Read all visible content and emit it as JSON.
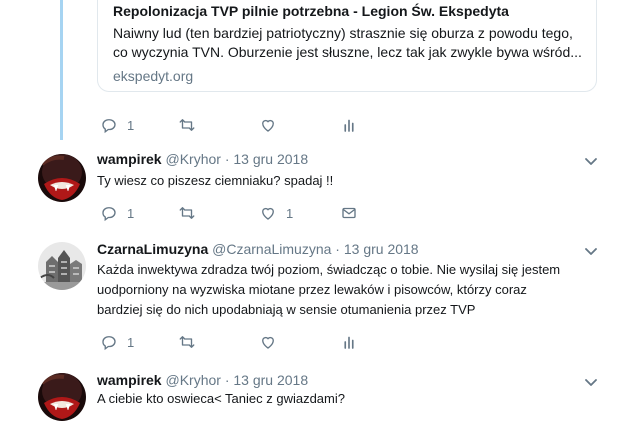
{
  "card": {
    "title": "Repolonizacja TVP pilnie potrzebna - Legion Św. Ekspedyta",
    "desc_line1": "Naiwny lud (ten bardziej patriotyczny) strasznie się oburza z powodu tego,",
    "desc_line2": "co wyczynia TVN. Oburzenie jest słuszne, lecz tak jak zwykle bywa wśród...",
    "domain": "ekspedyt.org"
  },
  "tweet0_actions": {
    "reply_count": "1",
    "retweet_count": "",
    "like_count": ""
  },
  "tweets": [
    {
      "name": "wampirek",
      "handle": "@Kryhor",
      "dot": "·",
      "time": "13 gru 2018",
      "text": "Ty wiesz co piszesz ciemniaku? spadaj !!",
      "reply_count": "1",
      "like_count": "1"
    },
    {
      "name": "CzarnaLimuzyna",
      "handle": "@CzarnaLimuzyna",
      "dot": "·",
      "time": "13 gru 2018",
      "text_line1": "Każda inwektywa zdradza twój poziom, świadcząc o tobie. Nie wysilaj się jestem",
      "text_line2": "uodporniony na wyzwiska miotane przez lewaków i pisowców, którzy coraz",
      "text_line3": "bardziej się do nich upodabniają w sensie otumanienia przez TVP",
      "reply_count": "1"
    },
    {
      "name": "wampirek",
      "handle": "@Kryhor",
      "dot": "·",
      "time": "13 gru 2018",
      "text": "A ciebie kto oswieca< Taniec z gwiazdami?"
    }
  ],
  "colors": {
    "thread_line": "#a6d4f2",
    "muted": "#657786",
    "text": "#14171a"
  },
  "icons": [
    "reply-icon",
    "retweet-icon",
    "like-icon",
    "analytics-icon",
    "dm-icon",
    "chevron-down-icon"
  ]
}
